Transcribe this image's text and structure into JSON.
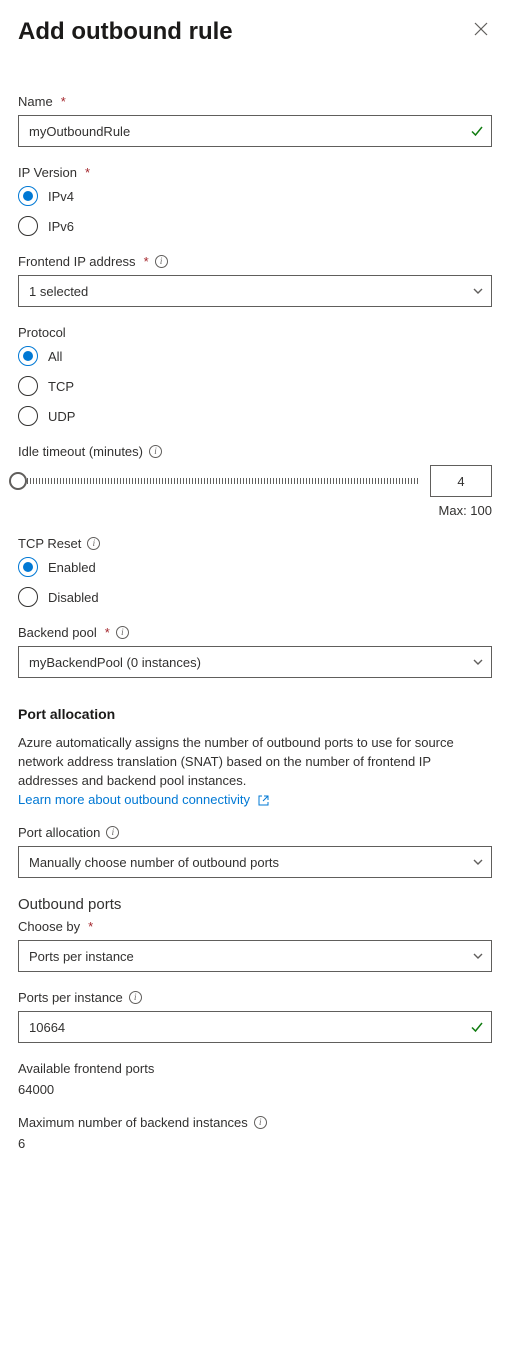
{
  "header": {
    "title": "Add outbound rule"
  },
  "fields": {
    "name": {
      "label": "Name",
      "value": "myOutboundRule"
    },
    "ipVersion": {
      "label": "IP Version",
      "options": {
        "ipv4": "IPv4",
        "ipv6": "IPv6"
      },
      "selected": "ipv4"
    },
    "frontendIp": {
      "label": "Frontend IP address",
      "value": "1 selected"
    },
    "protocol": {
      "label": "Protocol",
      "options": {
        "all": "All",
        "tcp": "TCP",
        "udp": "UDP"
      },
      "selected": "all"
    },
    "idleTimeout": {
      "label": "Idle timeout (minutes)",
      "value": "4",
      "maxLabel": "Max: 100"
    },
    "tcpReset": {
      "label": "TCP Reset",
      "options": {
        "enabled": "Enabled",
        "disabled": "Disabled"
      },
      "selected": "enabled"
    },
    "backendPool": {
      "label": "Backend pool",
      "value": "myBackendPool (0 instances)"
    },
    "portAllocSection": {
      "title": "Port allocation",
      "description": "Azure automatically assigns the number of outbound ports to use for source network address translation (SNAT) based on the number of frontend IP addresses and backend pool instances.",
      "linkText": "Learn more about outbound connectivity"
    },
    "portAllocation": {
      "label": "Port allocation",
      "value": "Manually choose number of outbound ports"
    },
    "outboundPortsTitle": "Outbound ports",
    "chooseBy": {
      "label": "Choose by",
      "value": "Ports per instance"
    },
    "portsPerInstance": {
      "label": "Ports per instance",
      "value": "10664"
    },
    "availableFrontendPorts": {
      "label": "Available frontend ports",
      "value": "64000"
    },
    "maxBackendInstances": {
      "label": "Maximum number of backend instances",
      "value": "6"
    }
  }
}
